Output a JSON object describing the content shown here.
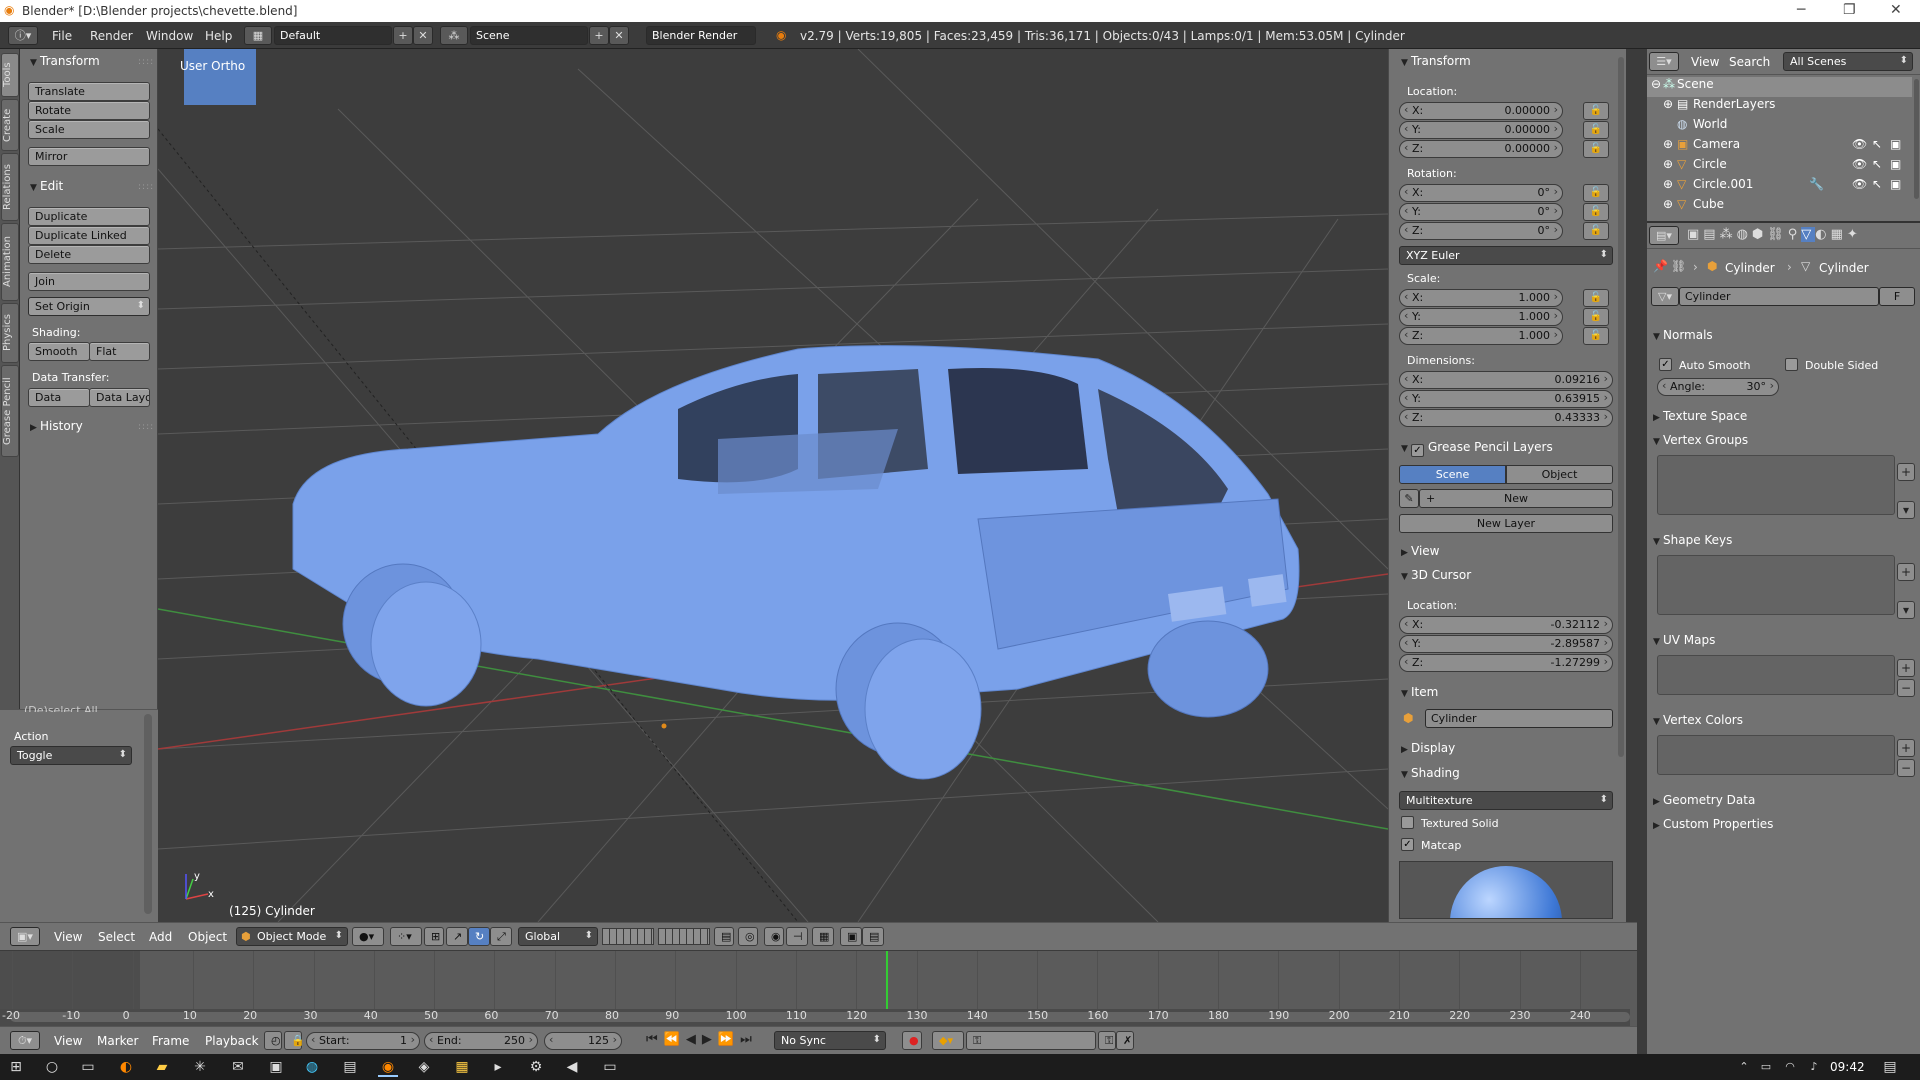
{
  "window": {
    "title": "Blender* [D:\\Blender projects\\chevette.blend]",
    "minimize": "─",
    "restore": "❐",
    "close": "✕"
  },
  "info": {
    "menus": [
      "File",
      "Render",
      "Window",
      "Help"
    ],
    "layout": "Default",
    "scene": "Scene",
    "engine": "Blender Render",
    "stats": "v2.79 | Verts:19,805 | Faces:23,459 | Tris:36,171 | Objects:0/43 | Lamps:0/1 | Mem:53.05M | Cylinder"
  },
  "vtabs": [
    "Tools",
    "Create",
    "Relations",
    "Animation",
    "Physics",
    "Grease Pencil"
  ],
  "tools": {
    "transform_header": "Transform",
    "translate": "Translate",
    "rotate": "Rotate",
    "scale": "Scale",
    "mirror": "Mirror",
    "edit_header": "Edit",
    "duplicate": "Duplicate",
    "duplicate_linked": "Duplicate Linked",
    "delete": "Delete",
    "join": "Join",
    "set_origin": "Set Origin",
    "shading_label": "Shading:",
    "smooth": "Smooth",
    "flat": "Flat",
    "data_transfer_label": "Data Transfer:",
    "data": "Data",
    "data_layo": "Data Layo",
    "history_header": "History"
  },
  "operator": {
    "cut_label": "(De)select All",
    "action_label": "Action",
    "action_value": "Toggle"
  },
  "viewport": {
    "view_name": "User Ortho",
    "object_info": "(125) Cylinder",
    "axis_x": "x",
    "axis_y": "y"
  },
  "npanel": {
    "transform": "Transform",
    "location_label": "Location:",
    "location": [
      {
        "k": "X:",
        "v": "0.00000"
      },
      {
        "k": "Y:",
        "v": "0.00000"
      },
      {
        "k": "Z:",
        "v": "0.00000"
      }
    ],
    "rotation_label": "Rotation:",
    "rotation": [
      {
        "k": "X:",
        "v": "0°"
      },
      {
        "k": "Y:",
        "v": "0°"
      },
      {
        "k": "Z:",
        "v": "0°"
      }
    ],
    "rotation_mode": "XYZ Euler",
    "scale_label": "Scale:",
    "scale": [
      {
        "k": "X:",
        "v": "1.000"
      },
      {
        "k": "Y:",
        "v": "1.000"
      },
      {
        "k": "Z:",
        "v": "1.000"
      }
    ],
    "dimensions_label": "Dimensions:",
    "dimensions": [
      {
        "k": "X:",
        "v": "0.09216"
      },
      {
        "k": "Y:",
        "v": "0.63915"
      },
      {
        "k": "Z:",
        "v": "0.43333"
      }
    ],
    "grease_pencil": "Grease Pencil Layers",
    "gp_scene": "Scene",
    "gp_object": "Object",
    "gp_new": "New",
    "gp_new_layer": "New Layer",
    "view": "View",
    "cursor": "3D Cursor",
    "cursor_location_label": "Location:",
    "cursor_location": [
      {
        "k": "X:",
        "v": "-0.32112"
      },
      {
        "k": "Y:",
        "v": "-2.89587"
      },
      {
        "k": "Z:",
        "v": "-1.27299"
      }
    ],
    "item": "Item",
    "item_name": "Cylinder",
    "display": "Display",
    "shading": "Shading",
    "shading_mode": "Multitexture",
    "textured_solid": "Textured Solid",
    "matcap": "Matcap"
  },
  "outliner": {
    "view": "View",
    "search": "Search",
    "filter": "All Scenes",
    "rows": [
      {
        "label": "Scene",
        "indent": 0
      },
      {
        "label": "RenderLayers",
        "indent": 1
      },
      {
        "label": "World",
        "indent": 1
      },
      {
        "label": "Camera",
        "indent": 1
      },
      {
        "label": "Circle",
        "indent": 1
      },
      {
        "label": "Circle.001",
        "indent": 1
      },
      {
        "label": "Cube",
        "indent": 1
      }
    ]
  },
  "props": {
    "breadcrumb_object": "Cylinder",
    "breadcrumb_mesh": "Cylinder",
    "mesh_name": "Cylinder",
    "fake_user": "F",
    "normals": "Normals",
    "auto_smooth": "Auto Smooth",
    "double_sided": "Double Sided",
    "angle_label": "Angle:",
    "angle_value": "30°",
    "texture_space": "Texture Space",
    "vertex_groups": "Vertex Groups",
    "shape_keys": "Shape Keys",
    "uv_maps": "UV Maps",
    "vertex_colors": "Vertex Colors",
    "geometry_data": "Geometry Data",
    "custom_properties": "Custom Properties"
  },
  "viewheader": {
    "view": "View",
    "select": "Select",
    "add": "Add",
    "object": "Object",
    "mode": "Object Mode",
    "orientation": "Global"
  },
  "timeline": {
    "ticks": [
      "-20",
      "-10",
      "0",
      "10",
      "20",
      "30",
      "40",
      "50",
      "60",
      "70",
      "80",
      "90",
      "100",
      "110",
      "120",
      "130",
      "140",
      "150",
      "160",
      "170",
      "180",
      "190",
      "200",
      "210",
      "220",
      "230",
      "240"
    ],
    "current_frame_tick": 125
  },
  "tlheader": {
    "view": "View",
    "marker": "Marker",
    "frame": "Frame",
    "playback": "Playback",
    "start": "Start:",
    "start_value": "1",
    "end": "End:",
    "end_value": "250",
    "current": "125",
    "sync": "No Sync"
  },
  "taskbar": {
    "time": "09:42"
  },
  "colors": {
    "car": "#7aa1ea",
    "viewport": "#3d3d3d",
    "panel": "#727272",
    "accent": "#5680c2",
    "grid_x": "#a03a3a",
    "grid_y": "#3f8e3f"
  }
}
